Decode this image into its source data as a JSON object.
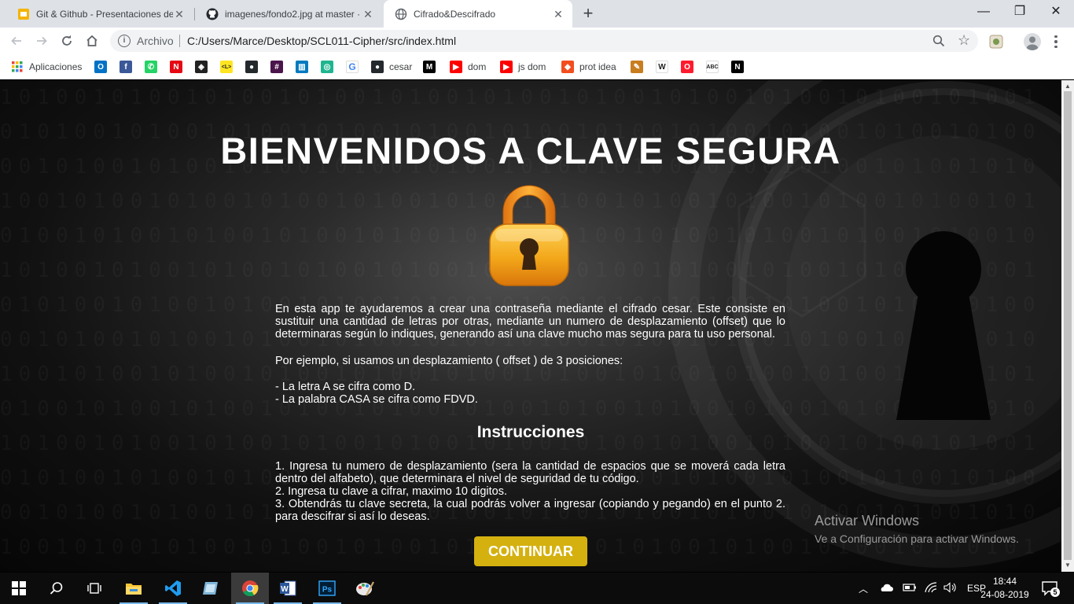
{
  "browser": {
    "tabs": [
      {
        "label": "Git & Github - Presentaciones de",
        "icon": "google-slides-icon",
        "color": "#f4b400"
      },
      {
        "label": "imagenes/fondo2.jpg at master ·",
        "icon": "github-icon"
      },
      {
        "label": "Cifrado&Descifrado",
        "icon": "globe-icon"
      }
    ],
    "close_glyph": "✕",
    "new_tab_glyph": "+",
    "window_controls": {
      "minimize": "—",
      "maximize": "❐",
      "close": "✕"
    },
    "omnibox": {
      "scheme_label": "Archivo",
      "url": "C:/Users/Marce/Desktop/SCL011-Cipher/src/index.html"
    },
    "bookmarks": [
      {
        "label": "Aplicaciones",
        "icon": "apps-grid-icon"
      },
      {
        "label": "",
        "icon": "outlook-icon",
        "color": "#0072c6",
        "glyph": "O"
      },
      {
        "label": "",
        "icon": "facebook-icon",
        "color": "#3b5998",
        "glyph": "f"
      },
      {
        "label": "",
        "icon": "whatsapp-icon",
        "color": "#25d366",
        "glyph": "✆"
      },
      {
        "label": "",
        "icon": "netflix-icon",
        "color": "#e50914",
        "glyph": "N"
      },
      {
        "label": "",
        "icon": "codepen-icon",
        "color": "#222222",
        "glyph": "◈"
      },
      {
        "label": "",
        "icon": "laboratoria-icon",
        "color": "#ffe521",
        "glyph": "<L>"
      },
      {
        "label": "",
        "icon": "github-icon",
        "color": "#24292e",
        "glyph": "●"
      },
      {
        "label": "",
        "icon": "slack-icon",
        "color": "#4a154b",
        "glyph": "#"
      },
      {
        "label": "",
        "icon": "trello-icon",
        "color": "#0079bf",
        "glyph": "▥"
      },
      {
        "label": "",
        "icon": "app-green-icon",
        "color": "#1fb58f",
        "glyph": "◎"
      },
      {
        "label": "",
        "icon": "google-icon",
        "color": "#ffffff",
        "glyph": "G"
      },
      {
        "label": "cesar",
        "icon": "github-icon",
        "color": "#24292e",
        "glyph": "●"
      },
      {
        "label": "",
        "icon": "medium-icon",
        "color": "#000000",
        "glyph": "M"
      },
      {
        "label": "dom",
        "icon": "youtube-icon",
        "color": "#ff0000",
        "glyph": "▶"
      },
      {
        "label": "js dom",
        "icon": "youtube-icon",
        "color": "#ff0000",
        "glyph": "▶"
      },
      {
        "label": "prot idea",
        "icon": "figma-icon",
        "color": "#f24e1e",
        "glyph": "◆"
      },
      {
        "label": "",
        "icon": "pencil-app-icon",
        "color": "#c87d1e",
        "glyph": "✎"
      },
      {
        "label": "",
        "icon": "wikipedia-icon",
        "color": "#ffffff",
        "glyph": "W"
      },
      {
        "label": "",
        "icon": "opera-icon",
        "color": "#ff1b2d",
        "glyph": "O"
      },
      {
        "label": "",
        "icon": "spellcheck-icon",
        "color": "#ffffff",
        "glyph": "ABC"
      },
      {
        "label": "",
        "icon": "notion-icon",
        "color": "#000000",
        "glyph": "N"
      }
    ]
  },
  "page": {
    "title": "BIENVENIDOS A CLAVE SEGURA",
    "intro": "En esta app te ayudaremos a crear una contraseña mediante el cifrado cesar. Este consiste en sustituir una cantidad de letras por otras, mediante un numero de desplazamiento (offset) que lo determinaras según lo indiques, generando así una clave mucho mas segura para tu uso personal.",
    "example_intro": "Por ejemplo, si usamos un desplazamiento ( offset ) de 3 posiciones:",
    "examples": [
      "- La letra A se cifra como D.",
      "- La palabra CASA se cifra como FDVD."
    ],
    "instructions_title": "Instrucciones",
    "instructions": [
      "1. Ingresa tu numero de desplazamiento (sera la cantidad de espacios que se moverá cada letra dentro del alfabeto), que determinara el nivel de seguridad de tu código.",
      "2. Ingresa tu clave a cifrar, maximo 10 digitos.",
      "3. Obtendrás tu clave secreta, la cual podrás volver a ingresar (copiando y pegando) en el punto 2. para descifrar si así lo deseas."
    ],
    "continue_button": "CONTINUAR",
    "accent_color": "#d4b10f"
  },
  "watermark": {
    "line1": "Activar Windows",
    "line2": "Ve a Configuración para activar Windows."
  },
  "taskbar": {
    "apps": [
      "windows-start-icon",
      "search-icon",
      "task-view-icon",
      "file-explorer-icon",
      "vscode-icon",
      "app-blue-icon",
      "chrome-icon",
      "word-icon",
      "photoshop-icon",
      "paint-icon"
    ],
    "language": "ESP",
    "time": "18:44",
    "date": "24-08-2019",
    "notification_count": "5"
  }
}
